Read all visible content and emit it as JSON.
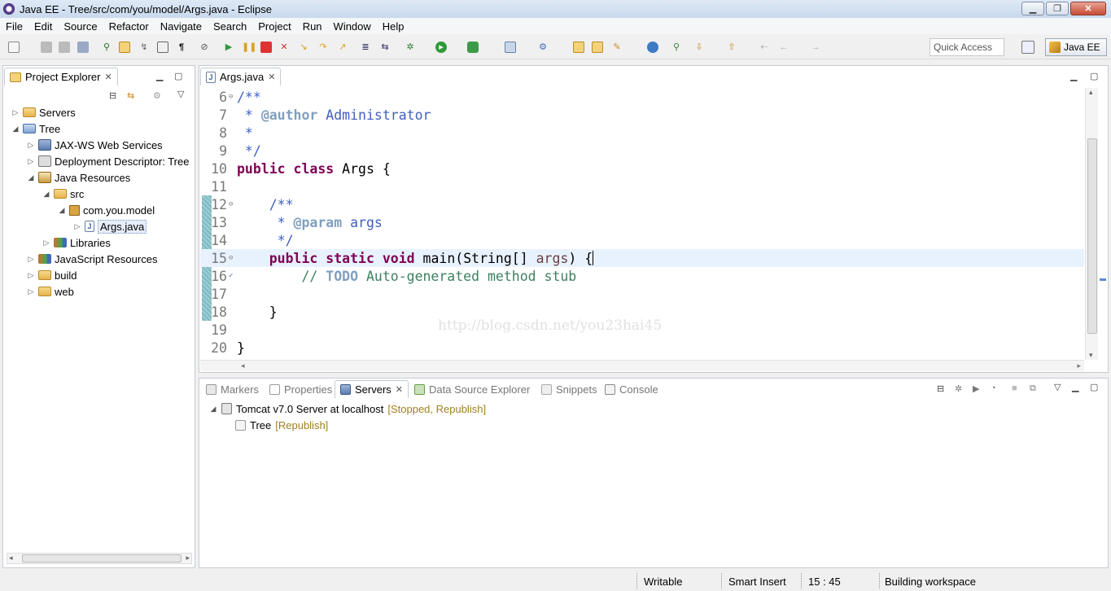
{
  "window": {
    "title": "Java EE - Tree/src/com/you/model/Args.java - Eclipse"
  },
  "menu": [
    "File",
    "Edit",
    "Source",
    "Refactor",
    "Navigate",
    "Search",
    "Project",
    "Run",
    "Window",
    "Help"
  ],
  "toolbar": {
    "quick_access": "Quick Access",
    "perspective": "Java EE"
  },
  "project_explorer": {
    "title": "Project Explorer",
    "items": [
      {
        "label": "Servers",
        "icon": "folder-icon",
        "expanded": false
      },
      {
        "label": "Tree",
        "icon": "project-icon",
        "expanded": true
      },
      {
        "label": "JAX-WS Web Services",
        "icon": "webservice-icon",
        "expanded": false
      },
      {
        "label": "Deployment Descriptor: Tree",
        "icon": "descriptor-icon",
        "expanded": false
      },
      {
        "label": "Java Resources",
        "icon": "java-resources-icon",
        "expanded": true
      },
      {
        "label": "src",
        "icon": "source-folder-icon",
        "expanded": true
      },
      {
        "label": "com.you.model",
        "icon": "package-icon",
        "expanded": true
      },
      {
        "label": "Args.java",
        "icon": "java-file-icon",
        "expanded": false
      },
      {
        "label": "Libraries",
        "icon": "libraries-icon",
        "expanded": false
      },
      {
        "label": "JavaScript Resources",
        "icon": "js-resources-icon",
        "expanded": false
      },
      {
        "label": "build",
        "icon": "folder-icon",
        "expanded": false
      },
      {
        "label": "web",
        "icon": "folder-icon",
        "expanded": false
      }
    ]
  },
  "editor": {
    "tab": "Args.java",
    "lines": [
      {
        "n": "6",
        "text": "/**"
      },
      {
        "n": "7",
        "text": " * @author Administrator"
      },
      {
        "n": "8",
        "text": " *"
      },
      {
        "n": "9",
        "text": " */"
      },
      {
        "n": "10",
        "text": "public class Args {"
      },
      {
        "n": "11",
        "text": ""
      },
      {
        "n": "12",
        "text": "    /**"
      },
      {
        "n": "13",
        "text": "     * @param args"
      },
      {
        "n": "14",
        "text": "     */"
      },
      {
        "n": "15",
        "text": "    public static void main(String[] args) {"
      },
      {
        "n": "16",
        "text": "        // TODO Auto-generated method stub"
      },
      {
        "n": "17",
        "text": ""
      },
      {
        "n": "18",
        "text": "    }"
      },
      {
        "n": "19",
        "text": ""
      },
      {
        "n": "20",
        "text": "}"
      }
    ],
    "watermark": "http://blog.csdn.net/you23hai45"
  },
  "bottom": {
    "tabs": [
      "Markers",
      "Properties",
      "Servers",
      "Data Source Explorer",
      "Snippets",
      "Console"
    ],
    "active_tab": "Servers",
    "servers": [
      {
        "label": "Tomcat v7.0 Server at localhost",
        "status": "[Stopped, Republish]"
      },
      {
        "label": "Tree",
        "status": "[Republish]"
      }
    ]
  },
  "statusbar": {
    "writable": "Writable",
    "insert_mode": "Smart Insert",
    "position": "15 : 45",
    "task": "Building workspace"
  }
}
